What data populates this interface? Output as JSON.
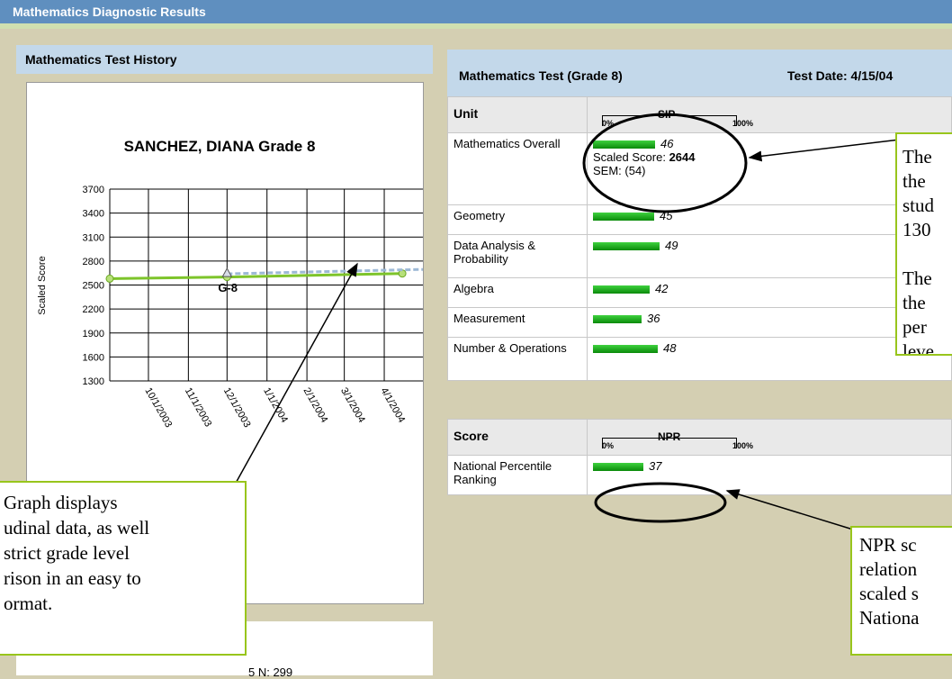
{
  "window": {
    "title": "Mathematics Diagnostic Results"
  },
  "history": {
    "header": "Mathematics Test History",
    "partial_text": "5   N: 299"
  },
  "chart_data": {
    "type": "line",
    "title": "SANCHEZ, DIANA Grade 8",
    "ylabel": "Scaled Score",
    "ylim": [
      1300,
      3700
    ],
    "yticks": [
      "3700",
      "3400",
      "3100",
      "2800",
      "2500",
      "2200",
      "1900",
      "1600",
      "1300"
    ],
    "xticks": [
      "10/1/2003",
      "11/1/2003",
      "12/1/2003",
      "1/1/2004",
      "2/1/2004",
      "3/1/2004",
      "4/1/2004"
    ],
    "marker_label": "G-8",
    "series": [
      {
        "values": [
          {
            "x": "9/1/2003",
            "y": 2580
          },
          {
            "x": "12/1/2003",
            "y": 2600
          },
          {
            "x": "4/15/2004",
            "y": 2644
          }
        ],
        "color": "#7dc42a"
      },
      {
        "values": [
          {
            "x": "12/1/2003",
            "y": 2640
          },
          {
            "x": "4/15/2004",
            "y": 2690
          }
        ],
        "color": "#9db9d6"
      }
    ]
  },
  "test": {
    "title": "Mathematics Test (Grade 8)",
    "date": "Test Date: 4/15/04",
    "unit_header": "Unit",
    "sip_label": "SIP",
    "scale_low": "0%",
    "scale_high": "100%",
    "overall": {
      "name": "Mathematics Overall",
      "value": "46",
      "pct": 46,
      "scaled_label": "Scaled Score:",
      "scaled_value": "2644",
      "sem": "SEM: (54)"
    },
    "units": [
      {
        "name": "Geometry",
        "value": "45",
        "pct": 45
      },
      {
        "name": "Data Analysis & Probability",
        "value": "49",
        "pct": 49
      },
      {
        "name": "Algebra",
        "value": "42",
        "pct": 42
      },
      {
        "name": "Measurement",
        "value": "36",
        "pct": 36
      },
      {
        "name": "Number & Operations",
        "value": "48",
        "pct": 48
      }
    ],
    "score_header": "Score",
    "npr_label": "NPR",
    "npr": {
      "name": "National Percentile Ranking",
      "value": "37",
      "pct": 37
    }
  },
  "callouts": {
    "graph": [
      "Graph displays",
      "udinal data, as well",
      "strict grade level",
      "rison in an easy to",
      "ormat."
    ],
    "top_right": [
      "The",
      "the",
      "stud",
      "130",
      "",
      "The",
      "the",
      "per",
      "leve"
    ],
    "npr": [
      "NPR sc",
      "relation",
      "scaled s",
      "Nationa"
    ]
  },
  "colors": {
    "bar": "#1fa81f",
    "accent": "#98c51c",
    "header": "#c3d8ea"
  }
}
